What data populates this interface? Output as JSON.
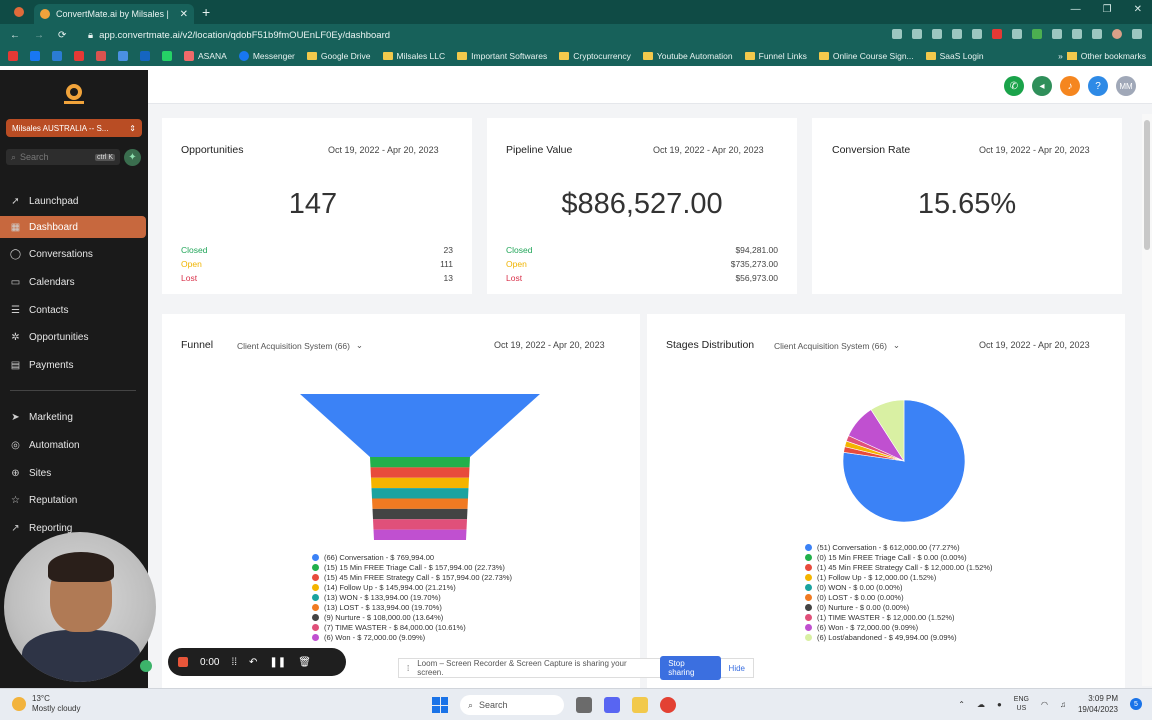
{
  "browser": {
    "tab_title": "ConvertMate.ai by Milsales |",
    "url": "app.convertmate.ai/v2/location/qdobF51b9fmOUEnLF0Ey/dashboard",
    "bookmarks": [
      "ASANA",
      "Messenger",
      "Google Drive",
      "Milsales LLC",
      "Important Softwares",
      "Cryptocurrency",
      "Youtube Automation",
      "Funnel Links",
      "Online Course Sign...",
      "SaaS Login"
    ],
    "other_bookmarks": "Other bookmarks"
  },
  "sidebar": {
    "location": "Milsales AUSTRALIA -- S...",
    "search_placeholder": "Search",
    "search_shortcut": "ctrl K",
    "items": [
      {
        "label": "Launchpad",
        "icon": "rocket-icon"
      },
      {
        "label": "Dashboard",
        "icon": "grid-icon"
      },
      {
        "label": "Conversations",
        "icon": "chat-icon"
      },
      {
        "label": "Calendars",
        "icon": "calendar-icon"
      },
      {
        "label": "Contacts",
        "icon": "contacts-icon"
      },
      {
        "label": "Opportunities",
        "icon": "funnel-icon"
      },
      {
        "label": "Payments",
        "icon": "payments-icon"
      },
      {
        "label": "Marketing",
        "icon": "send-icon"
      },
      {
        "label": "Automation",
        "icon": "automation-icon"
      },
      {
        "label": "Sites",
        "icon": "globe-icon"
      },
      {
        "label": "Reputation",
        "icon": "star-icon"
      },
      {
        "label": "Reporting",
        "icon": "chart-icon"
      }
    ],
    "user_initials": "MM"
  },
  "cards": {
    "opportunities": {
      "title": "Opportunities",
      "date": "Oct 19, 2022 - Apr 20, 2023",
      "value": "147",
      "rows": [
        {
          "label": "Closed",
          "value": "23"
        },
        {
          "label": "Open",
          "value": "111"
        },
        {
          "label": "Lost",
          "value": "13"
        }
      ]
    },
    "pipeline": {
      "title": "Pipeline Value",
      "date": "Oct 19, 2022 - Apr 20, 2023",
      "value": "$886,527.00",
      "rows": [
        {
          "label": "Closed",
          "value": "$94,281.00"
        },
        {
          "label": "Open",
          "value": "$735,273.00"
        },
        {
          "label": "Lost",
          "value": "$56,973.00"
        }
      ]
    },
    "conversion": {
      "title": "Conversion Rate",
      "date": "Oct 19, 2022 - Apr 20, 2023",
      "value": "15.65%"
    }
  },
  "funnel": {
    "title": "Funnel",
    "pipeline": "Client Acquisition System (66)",
    "date": "Oct 19, 2022 - Apr 20, 2023"
  },
  "stages": {
    "title": "Stages Distribution",
    "pipeline": "Client Acquisition System (66)",
    "date": "Oct 19, 2022 - Apr 20, 2023"
  },
  "chart_data": [
    {
      "type": "funnel",
      "title": "Funnel",
      "categories": [
        "Conversation",
        "15 Min FREE Triage Call",
        "45 Min FREE Strategy Call",
        "Follow Up",
        "WON",
        "LOST",
        "Nurture",
        "TIME WASTER",
        "Won"
      ],
      "counts": [
        66,
        15,
        15,
        14,
        13,
        13,
        9,
        7,
        6
      ],
      "colors": [
        "#3b82f6",
        "#22b04b",
        "#e84b3c",
        "#f4b400",
        "#1aa3a0",
        "#f07a22",
        "#444444",
        "#e0507a",
        "#c050d0"
      ],
      "legend": [
        "(66) Conversation - $ 769,994.00",
        "(15) 15 Min FREE Triage Call - $ 157,994.00 (22.73%)",
        "(15) 45 Min FREE Strategy Call - $ 157,994.00 (22.73%)",
        "(14) Follow Up - $ 145,994.00 (21.21%)",
        "(13) WON - $ 133,994.00 (19.70%)",
        "(13) LOST - $ 133,994.00 (19.70%)",
        "(9) Nurture - $ 108,000.00 (13.64%)",
        "(7) TIME WASTER - $ 84,000.00 (10.61%)",
        "(6) Won - $ 72,000.00 (9.09%)"
      ]
    },
    {
      "type": "pie",
      "title": "Stages Distribution",
      "categories": [
        "Conversation",
        "15 Min FREE Triage Call",
        "45 Min FREE Strategy Call",
        "Follow Up",
        "WON",
        "LOST",
        "Nurture",
        "TIME WASTER",
        "Won",
        "Lost/abandoned"
      ],
      "counts": [
        51,
        0,
        1,
        1,
        0,
        0,
        0,
        1,
        6,
        6
      ],
      "values": [
        77.27,
        0,
        1.52,
        1.52,
        0,
        0,
        0,
        1.52,
        9.09,
        9.09
      ],
      "colors": [
        "#3b82f6",
        "#22b04b",
        "#e84b3c",
        "#f4b400",
        "#1aa3a0",
        "#f07a22",
        "#444444",
        "#e0507a",
        "#c050d0",
        "#d9f0a3"
      ],
      "legend": [
        "(51) Conversation - $ 612,000.00 (77.27%)",
        "(0) 15 Min FREE Triage Call - $ 0.00 (0.00%)",
        "(1) 45 Min FREE Strategy Call - $ 12,000.00 (1.52%)",
        "(1) Follow Up - $ 12,000.00 (1.52%)",
        "(0) WON - $ 0.00 (0.00%)",
        "(0) LOST - $ 0.00 (0.00%)",
        "(0) Nurture - $ 0.00 (0.00%)",
        "(1) TIME WASTER - $ 12,000.00 (1.52%)",
        "(6) Won - $ 72,000.00 (9.09%)",
        "(6) Lost/abandoned - $ 49,994.00 (9.09%)"
      ]
    }
  ],
  "recorder": {
    "time": "0:00",
    "loom_text": "Loom – Screen Recorder & Screen Capture is sharing your screen.",
    "stop_label": "Stop sharing",
    "hide_label": "Hide"
  },
  "taskbar": {
    "temp": "13°C",
    "weather": "Mostly cloudy",
    "search": "Search",
    "lang": "ENG",
    "region": "US",
    "time": "3:09 PM",
    "date": "19/04/2023"
  }
}
